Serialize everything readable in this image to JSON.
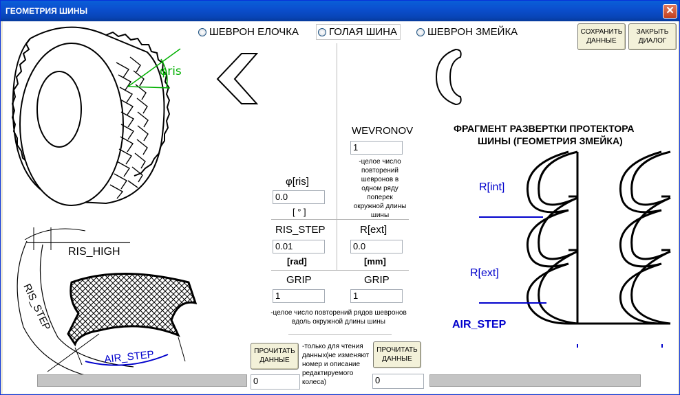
{
  "window": {
    "title": "ГЕОМЕТРИЯ ШИНЫ",
    "close_label": "✕"
  },
  "radios": [
    {
      "label": "ШЕВРОН ЕЛОЧКА",
      "checked": false
    },
    {
      "label": "ГОЛАЯ ШИНА",
      "checked": false
    },
    {
      "label": "ШЕВРОН ЗМЕЙКА",
      "checked": false
    }
  ],
  "buttons": {
    "save": "СОХРАНИТЬ ДАННЫЕ",
    "close_dialog": "ЗАКРЫТЬ ДИАЛОГ",
    "read_left": "ПРОЧИТАТЬ ДАННЫЕ",
    "read_right": "ПРОЧИТАТЬ ДАННЫЕ"
  },
  "tire_diagram": {
    "angle_label": "φris"
  },
  "bottom_left_diagram": {
    "ris_high": "RIS_HIGH",
    "ris_step": "RIS_STEP",
    "air_step": "AIR_STEP"
  },
  "right_diagram": {
    "title_line1": "ФРАГМЕНТ РАЗВЕРТКИ ПРОТЕКТОРА",
    "title_line2": "ШИНЫ (ГЕОМЕТРИЯ ЗМЕЙКА)",
    "r_int": "R[int]",
    "r_ext": "R[ext]",
    "air_step": "AIR_STEP"
  },
  "params": {
    "wevronov_label": "WEVRONOV",
    "wevronov_value": "1",
    "wevronov_hint": "-целое число повторений шевронов в одном ряду поперек окружной длины шины",
    "phi_label": "φ[ris]",
    "phi_value": "0.0",
    "phi_unit": "[ ° ]",
    "ris_step_label": "RIS_STEP",
    "ris_step_value": "0.01",
    "ris_step_unit": "[rad]",
    "r_ext_label": "R[ext]",
    "r_ext_value": "0.0",
    "r_ext_unit": "[mm]",
    "grip_left_label": "GRIP",
    "grip_left_value": "1",
    "grip_right_label": "GRIP",
    "grip_right_value": "1",
    "grip_hint": "-целое число повторений рядов шевронов вдоль окружной длины шины",
    "readonly_hint": "-только для чтения данных(не изменяют номер и описание редактируемого колеса)"
  },
  "status": {
    "left_counter": "0",
    "right_counter": "0"
  },
  "colors": {
    "accent_green": "#00b000",
    "accent_blue": "#0000cc",
    "title_bar": "#0a5fd8"
  }
}
